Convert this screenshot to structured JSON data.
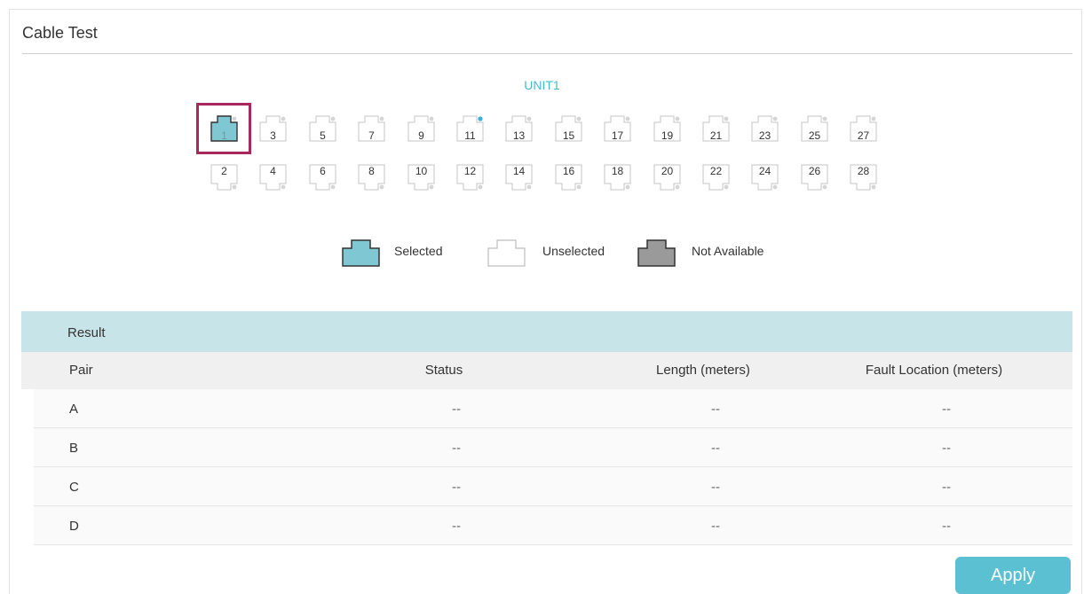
{
  "panel": {
    "title": "Cable Test"
  },
  "unit": {
    "label": "UNIT1"
  },
  "ports": {
    "top": [
      "1",
      "3",
      "5",
      "7",
      "9",
      "11",
      "13",
      "15",
      "17",
      "19",
      "21",
      "23",
      "25",
      "27"
    ],
    "bottom": [
      "2",
      "4",
      "6",
      "8",
      "10",
      "12",
      "14",
      "16",
      "18",
      "20",
      "22",
      "24",
      "26",
      "28"
    ],
    "selected": "1",
    "link_active": "11"
  },
  "legend": {
    "selected": "Selected",
    "unselected": "Unselected",
    "not_available": "Not Available"
  },
  "result": {
    "title": "Result",
    "columns": [
      "Pair",
      "Status",
      "Length (meters)",
      "Fault Location (meters)"
    ],
    "rows": [
      [
        "A",
        "--",
        "--",
        "--"
      ],
      [
        "B",
        "--",
        "--",
        "--"
      ],
      [
        "C",
        "--",
        "--",
        "--"
      ],
      [
        "D",
        "--",
        "--",
        "--"
      ]
    ]
  },
  "actions": {
    "apply": "Apply"
  },
  "colors": {
    "accent": "#5bc1d2",
    "selected_port": "#7fc7d2",
    "not_available_port": "#9a9a9a",
    "selection_frame": "#a8285e",
    "link_dot": "#3aaee0"
  }
}
